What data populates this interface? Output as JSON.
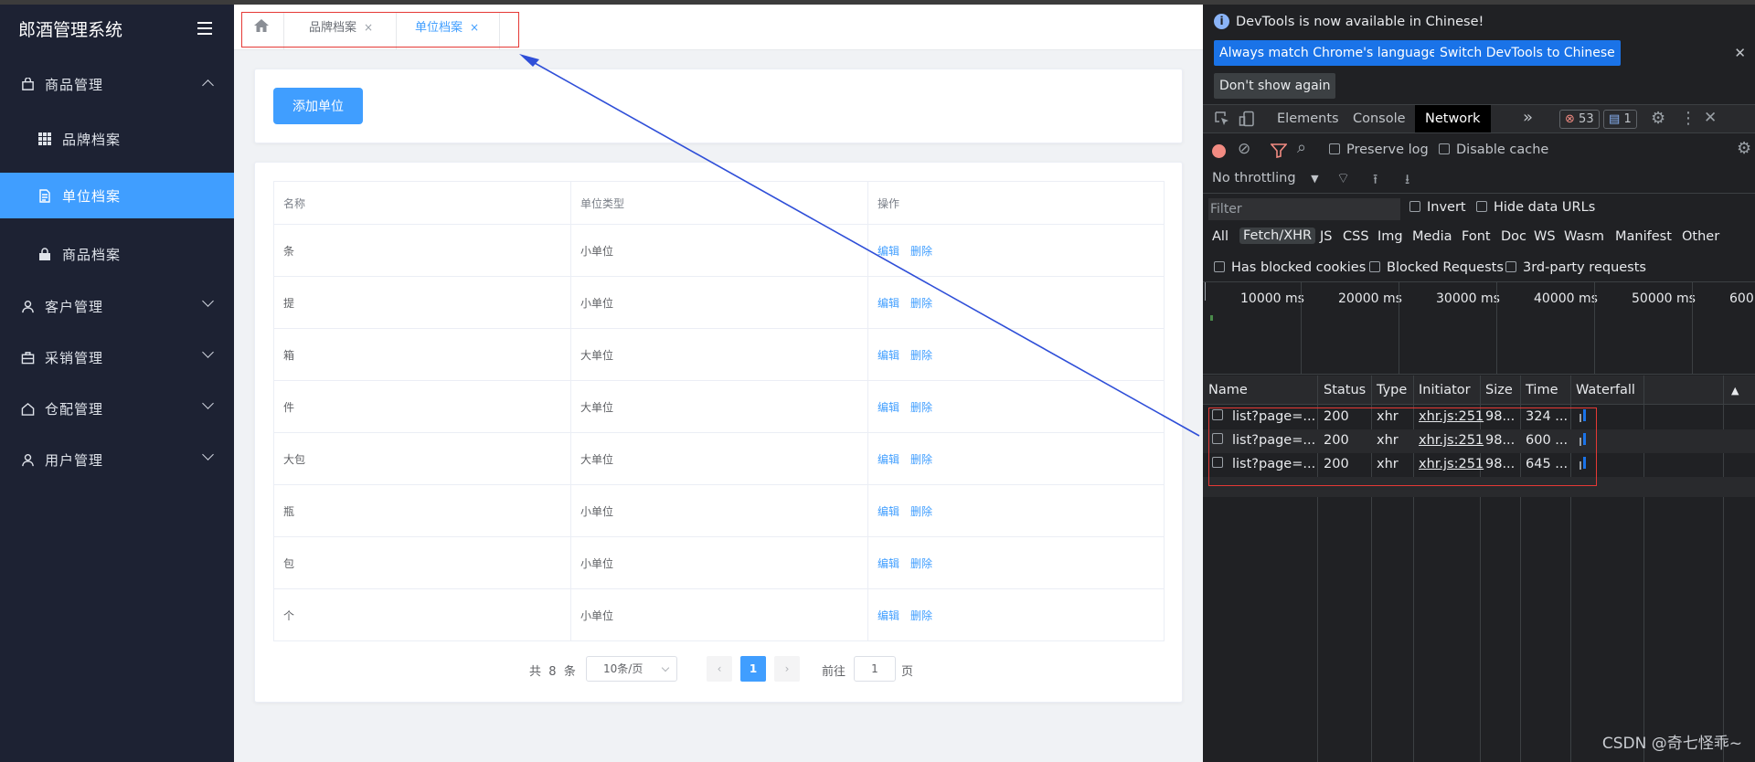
{
  "app": {
    "title": "郎酒管理系统"
  },
  "sidebar": {
    "groups": [
      {
        "label": "商品管理",
        "icon": "bag-icon"
      },
      {
        "label": "客户管理",
        "icon": "user-icon"
      },
      {
        "label": "采销管理",
        "icon": "briefcase-icon"
      },
      {
        "label": "仓配管理",
        "icon": "house-icon"
      },
      {
        "label": "用户管理",
        "icon": "user-icon"
      }
    ],
    "sub_items": [
      {
        "label": "品牌档案",
        "icon": "grid-icon",
        "active": false
      },
      {
        "label": "单位档案",
        "icon": "document-icon",
        "active": true
      },
      {
        "label": "商品档案",
        "icon": "lock-icon",
        "active": false
      }
    ]
  },
  "tabs": [
    {
      "label": "品牌档案",
      "close": "×"
    },
    {
      "label": "单位档案",
      "close": "×"
    }
  ],
  "toolbar": {
    "add_label": "添加单位"
  },
  "table": {
    "headers": [
      "名称",
      "单位类型",
      "操作"
    ],
    "rows": [
      {
        "name": "条",
        "type": "小单位"
      },
      {
        "name": "提",
        "type": "小单位"
      },
      {
        "name": "箱",
        "type": "大单位"
      },
      {
        "name": "件",
        "type": "大单位"
      },
      {
        "name": "大包",
        "type": "大单位"
      },
      {
        "name": "瓶",
        "type": "小单位"
      },
      {
        "name": "包",
        "type": "小单位"
      },
      {
        "name": "个",
        "type": "小单位"
      }
    ],
    "actions": {
      "edit": "编辑",
      "delete": "删除"
    }
  },
  "pagination": {
    "total_prefix": "共",
    "total": "8",
    "total_suffix": "条",
    "page_size": "10条/页",
    "prev": "‹",
    "current": "1",
    "next": "›",
    "goto_label": "前往",
    "goto_value": "1",
    "page_suffix": "页"
  },
  "devtools": {
    "info_text": "DevTools is now available in Chinese!",
    "btn_match": "Always match Chrome's language",
    "btn_switch": "Switch DevTools to Chinese",
    "btn_dont_show": "Don't show again",
    "tabs": [
      "Elements",
      "Console",
      "Network"
    ],
    "active_tab": "Network",
    "more": "»",
    "error_count": "53",
    "message_count": "1",
    "preserve_log": "Preserve log",
    "disable_cache": "Disable cache",
    "throttling": "No throttling",
    "filter_placeholder": "Filter",
    "invert": "Invert",
    "hide_data_urls": "Hide data URLs",
    "types": [
      "All",
      "Fetch/XHR",
      "JS",
      "CSS",
      "Img",
      "Media",
      "Font",
      "Doc",
      "WS",
      "Wasm",
      "Manifest",
      "Other"
    ],
    "selected_type": "Fetch/XHR",
    "blocked_cookies": "Has blocked cookies",
    "blocked_requests": "Blocked Requests",
    "third_party": "3rd-party requests",
    "timeline_labels": [
      "10000 ms",
      "20000 ms",
      "30000 ms",
      "40000 ms",
      "50000 ms",
      "600"
    ],
    "columns": [
      "Name",
      "Status",
      "Type",
      "Initiator",
      "Size",
      "Time",
      "Waterfall"
    ],
    "requests": [
      {
        "name": "list?page=...",
        "status": "200",
        "type": "xhr",
        "initiator": "xhr.js:251",
        "size": "98...",
        "time": "324 ..."
      },
      {
        "name": "list?page=...",
        "status": "200",
        "type": "xhr",
        "initiator": "xhr.js:251",
        "size": "98...",
        "time": "600 ..."
      },
      {
        "name": "list?page=...",
        "status": "200",
        "type": "xhr",
        "initiator": "xhr.js:251",
        "size": "98...",
        "time": "645 ..."
      }
    ]
  },
  "watermark": "CSDN @奇七怪乖~",
  "colors": {
    "primary": "#409eff",
    "sidebar": "#1d2233",
    "annotation_red": "#e53935",
    "annotation_arrow": "#2f4fd8"
  }
}
